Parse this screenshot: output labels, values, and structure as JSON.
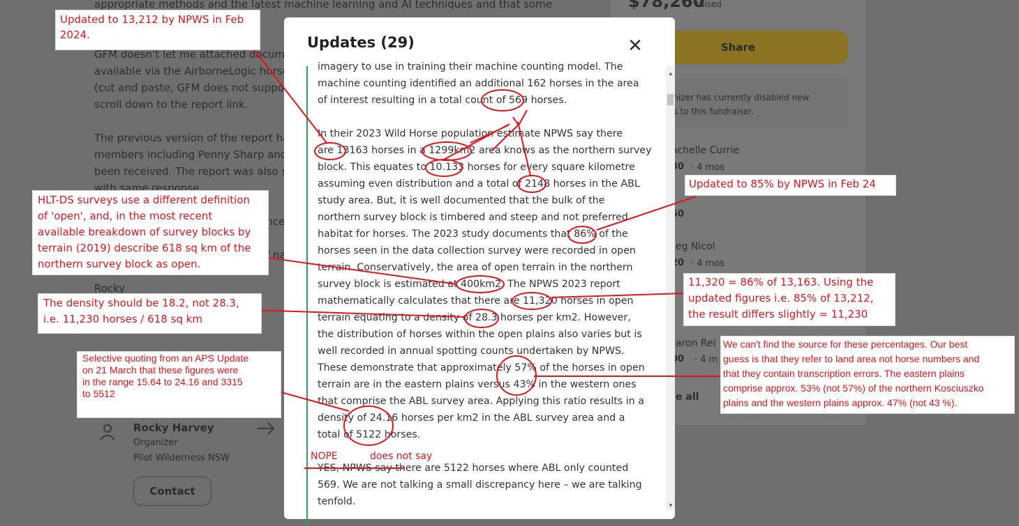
{
  "background": {
    "left_lines": [
      "appropriate methods and the latest machine learning and AI techniques and that some",
      "GFM doesn't let me attached documen",
      "available via the AirborneLogic horse c",
      "(cut and paste, GFM does not support",
      "scroll down to the report link.",
      "The previous version of the report has",
      "members including Penny Sharp and lo",
      "been received. The report was also ser",
      "with same response.",
      "ence",
      "of na",
      "Rocky"
    ],
    "raised_amount": "$78,260",
    "raised_label": "raised",
    "share_label": "Share",
    "disabled_note": "anizer has currently disabled new\nns to this fundraiser.",
    "donors": [
      {
        "name": "achelle Currie",
        "amount": "30",
        "time": "· 4 mos"
      },
      {
        "name": "",
        "amount": "50",
        "time": ""
      },
      {
        "name": "eg Nicol",
        "amount": "20",
        "time": "· 4 mos"
      },
      {
        "name": "aron Rei",
        "amount": "00",
        "time": "· 4 m"
      }
    ],
    "see_all": "e all",
    "organizer_name": "Rocky Harvey",
    "organizer_role": "Organizer",
    "organizer_place": "Pilot Wilderness NSW",
    "contact_label": "Contact"
  },
  "modal": {
    "title": "Updates (29)",
    "close_icon": "close-icon",
    "body": "imagery to use in training their machine counting model. The\nmachine counting identified an additional 162 horses in the area\nof interest resulting in a total count of 569 horses.\n\nIn their 2023 Wild Horse population estimate NPWS say there\nare 13163 horses in a 1299km2 area knows as the northern survey\nblock. This equates to 10.133 horses for every square kilometre\nassuming even distribution and a total of 2148 horses in the ABL\nstudy area. But, it is well documented that the bulk of the\nnorthern survey block is timbered and steep and not preferred\nhabitat for horses. The 2023 study documents that 86% of the\nhorses seen in the data collection survey were recorded in open\nterrain. Conservatively, the area of open terrain in the northern\nsurvey block is estimated at 400km2. The NPWS 2023 report\nmathematically calculates that there are 11,320 horses in open\nterrain equating to a density of 28.3 horses per km2. However,\nthe distribution of horses within the open plains also varies but is\nwell recorded in annual spotting counts undertaken by NPWS.\nThese demonstrate that approximately 57% of the horses in open\nterrain are in the eastern plains versus 43% in the western ones\nthat comprise the ABL survey area. Applying this ratio results in a\ndensity of 24.16 horses per km2 in the ABL survey area and a\ntotal of 5122 horses.\n\nYES, NPWS say there are 5122 horses where ABL only counted\n569. We are not talking a small discrepancy here – we are talking\ntenfold."
  },
  "annotations": {
    "a1": "Updated to 13,212 by NPWS in Feb\n 2024.",
    "a2": "HLT-DS surveys use a different definition\nof 'open', and, in the most recent\navailable breakdown of survey blocks by\nterrain (2019) describe 618 sq km of the\n northern survey block as open.",
    "a3": "The density should be 18.2, not 28.3,\n i.e. 11,230 horses / 618 sq km",
    "a4": "Selective quoting from an APS Update\non 21 March that these figures were\nin the range 15.64 to 24.16 and 3315\nto 5512",
    "a5": "Updated to 85% by NPWS in Feb 24",
    "a6": "11,320 = 86% of 13,163. Using the\n updated figures i.e. 85% of 13,212,\n the result differs slightly = 11,230",
    "a7": "We can't find the source for these percentages. Our best\nguess is that they refer to land area not horse numbers and\nthat they contain transcription errors. The eastern plains\ncomprise approx. 53% (not 57%) of the northern Kosciuszko\nplains and the western plains approx. 47% (not 43 %).",
    "nope": "NOPE",
    "does_not_say": "does not say"
  },
  "colors": {
    "annotation_red": "#e3141b",
    "timeline_green": "#2da160",
    "overlay_gray": "#6f6f6f"
  }
}
